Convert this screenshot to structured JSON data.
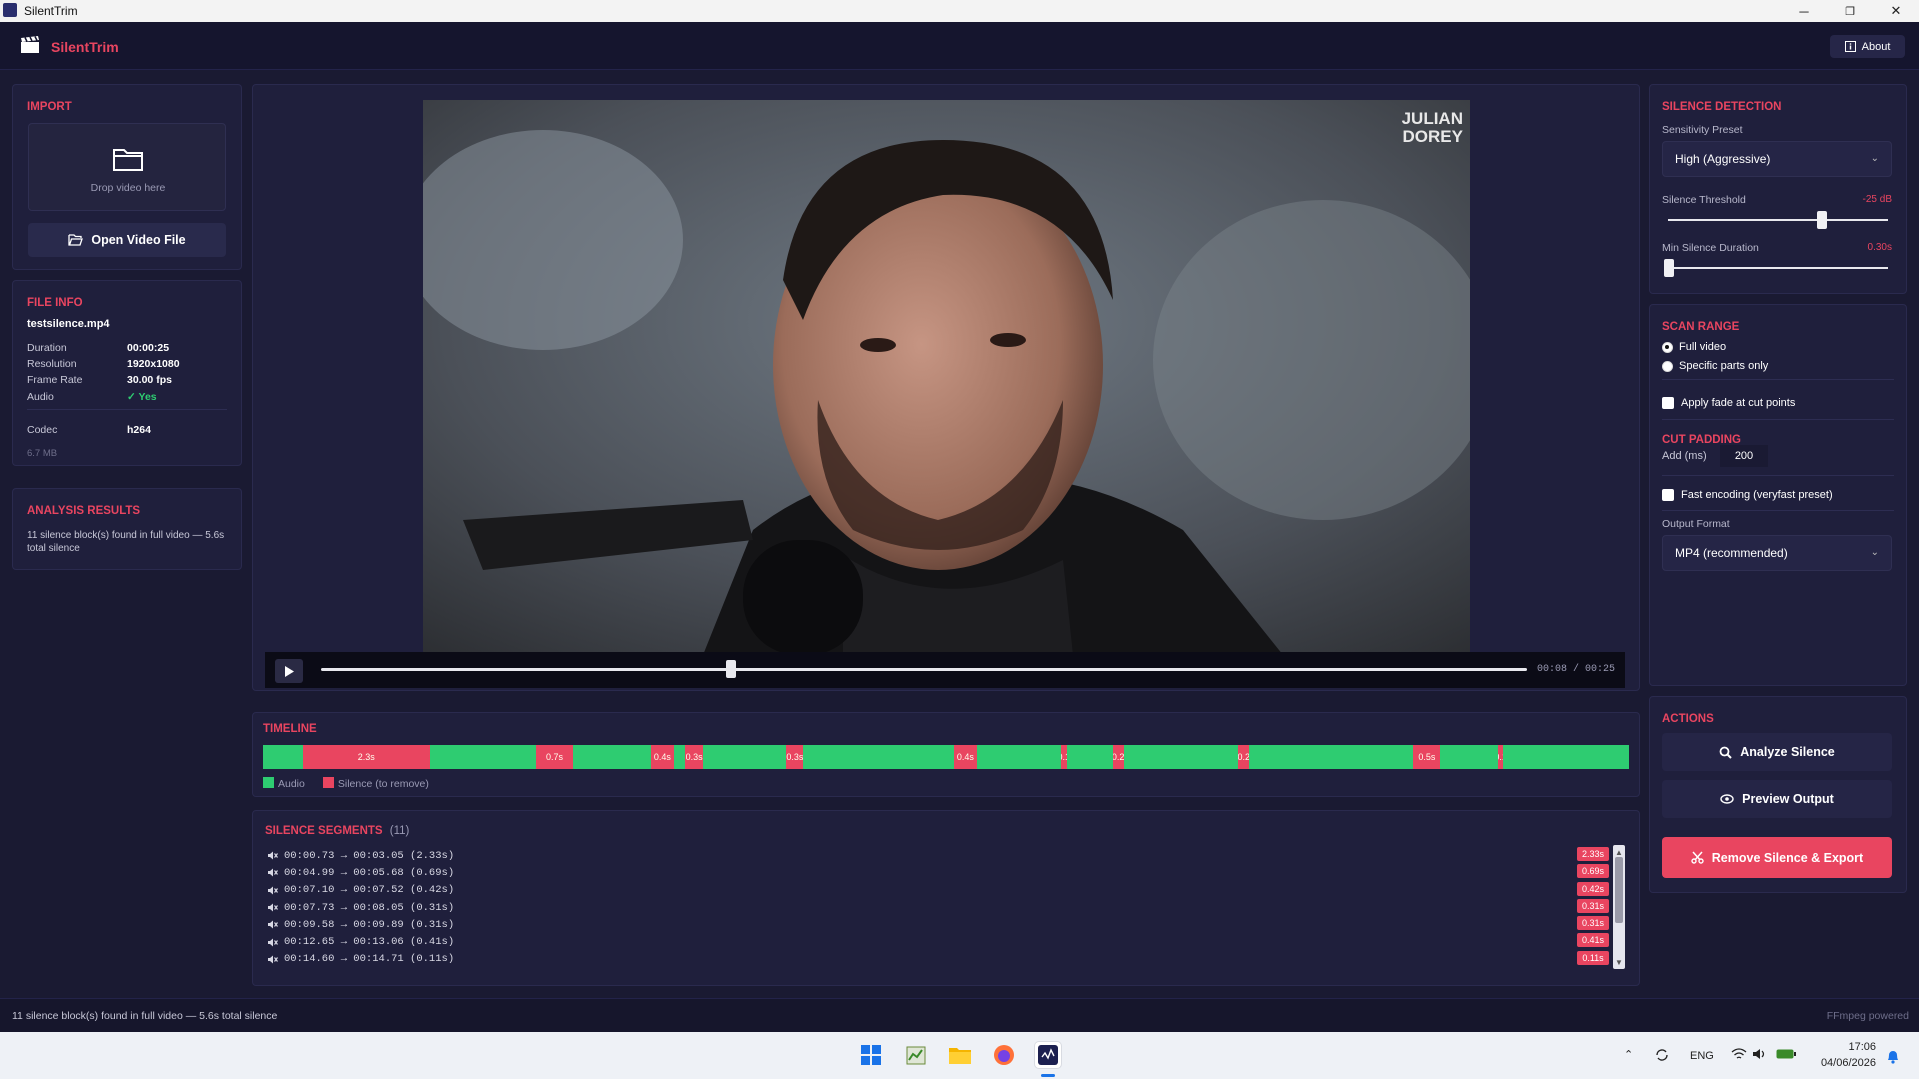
{
  "window": {
    "title": "SilentTrim",
    "minimize": "─",
    "maximize": "❐",
    "close": "✕"
  },
  "header": {
    "brand": "SilentTrim",
    "about_label": "About"
  },
  "import": {
    "title": "IMPORT",
    "drop_text": "Drop video here",
    "open_label": "Open Video File"
  },
  "file_info": {
    "title": "FILE INFO",
    "filename": "testsilence.mp4",
    "rows": [
      {
        "key": "Duration",
        "value": "00:00:25"
      },
      {
        "key": "Resolution",
        "value": "1920x1080"
      },
      {
        "key": "Frame Rate",
        "value": "30.00 fps"
      },
      {
        "key": "Audio",
        "value": "✓ Yes"
      }
    ],
    "codec_key": "Codec",
    "codec_value": "h264",
    "size": "6.7 MB"
  },
  "analysis": {
    "title": "ANALYSIS RESULTS",
    "text": "11 silence block(s) found in full video — 5.6s total silence"
  },
  "video": {
    "watermark_line1": "JULIAN",
    "watermark_line2": "DOREY",
    "time": "00:08 / 00:25",
    "progress": 0.34
  },
  "timeline": {
    "title": "TIMELINE",
    "legend_audio": "Audio",
    "legend_silence": "Silence (to remove)",
    "duration_s": 25,
    "segments": [
      {
        "start": 0.73,
        "end": 3.05,
        "label": "2.3s"
      },
      {
        "start": 4.99,
        "end": 5.68,
        "label": "0.7s"
      },
      {
        "start": 7.1,
        "end": 7.52,
        "label": "0.4s"
      },
      {
        "start": 7.73,
        "end": 8.05,
        "label": "0.3s"
      },
      {
        "start": 9.58,
        "end": 9.89,
        "label": "0.3s"
      },
      {
        "start": 12.65,
        "end": 13.06,
        "label": "0.4s"
      },
      {
        "start": 14.6,
        "end": 14.71,
        "label": "0.1"
      },
      {
        "start": 15.55,
        "end": 15.75,
        "label": "0.2"
      },
      {
        "start": 17.85,
        "end": 18.05,
        "label": "0.2"
      },
      {
        "start": 21.05,
        "end": 21.55,
        "label": "0.5s"
      },
      {
        "start": 22.6,
        "end": 22.7,
        "label": "0.1"
      }
    ]
  },
  "segments_list": {
    "title": "SILENCE SEGMENTS",
    "count": "(11)",
    "rows": [
      {
        "text": "00:00.73 → 00:03.05 (2.33s)",
        "badge": "2.33s"
      },
      {
        "text": "00:04.99 → 00:05.68 (0.69s)",
        "badge": "0.69s"
      },
      {
        "text": "00:07.10 → 00:07.52 (0.42s)",
        "badge": "0.42s"
      },
      {
        "text": "00:07.73 → 00:08.05 (0.31s)",
        "badge": "0.31s"
      },
      {
        "text": "00:09.58 → 00:09.89 (0.31s)",
        "badge": "0.31s"
      },
      {
        "text": "00:12.65 → 00:13.06 (0.41s)",
        "badge": "0.41s"
      },
      {
        "text": "00:14.60 → 00:14.71 (0.11s)",
        "badge": "0.11s"
      }
    ]
  },
  "silence_detection": {
    "title": "SILENCE DETECTION",
    "preset_label": "Sensitivity Preset",
    "preset_value": "High (Aggressive)",
    "threshold_label": "Silence Threshold",
    "threshold_value": "-25 dB",
    "threshold_pos": 0.7,
    "min_dur_label": "Min Silence Duration",
    "min_dur_value": "0.30s",
    "min_dur_pos": 0.0
  },
  "scan_range": {
    "title": "SCAN RANGE",
    "opt_full": "Full video",
    "opt_parts": "Specific parts only",
    "fade_label": "Apply fade at cut points"
  },
  "cut_padding": {
    "title": "CUT PADDING",
    "add_label": "Add (ms)",
    "add_value": "200",
    "fast_label": "Fast encoding (veryfast preset)",
    "format_label": "Output Format",
    "format_value": "MP4 (recommended)"
  },
  "actions": {
    "title": "ACTIONS",
    "analyze": "Analyze Silence",
    "preview": "Preview Output",
    "remove": "Remove Silence & Export"
  },
  "status": {
    "left": "11 silence block(s) found in full video — 5.6s total silence",
    "right": "FFmpeg powered"
  },
  "taskbar": {
    "lang": "ENG",
    "time": "17:06",
    "date": "04/06/2026"
  },
  "colors": {
    "accent": "#e94560",
    "audio_green": "#2ecc71",
    "bg": "#1a1a32"
  }
}
